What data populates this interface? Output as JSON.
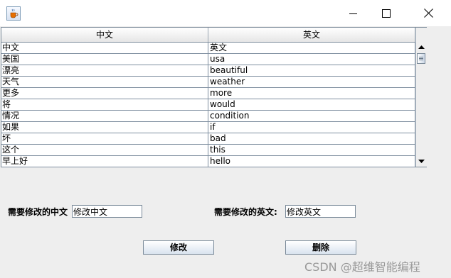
{
  "window": {
    "icon": "java-cup-icon",
    "controls": [
      "minimize-icon",
      "maximize-icon",
      "close-icon"
    ]
  },
  "table": {
    "columns": [
      "中文",
      "英文"
    ],
    "rows": [
      [
        "中文",
        "英文"
      ],
      [
        "美国",
        "usa"
      ],
      [
        "漂亮",
        "beautiful"
      ],
      [
        "天气",
        "weather"
      ],
      [
        "更多",
        "more"
      ],
      [
        "将",
        "would"
      ],
      [
        "情况",
        "condition"
      ],
      [
        "如果",
        "if"
      ],
      [
        "坏",
        "bad"
      ],
      [
        "这个",
        "this"
      ],
      [
        "早上好",
        "hello"
      ]
    ]
  },
  "form": {
    "cn_label": "需要修改的中文",
    "cn_value": "修改中文",
    "en_label": "需要修改的英文:",
    "en_value": "修改英文"
  },
  "buttons": {
    "edit": "修改",
    "delete": "删除"
  },
  "watermark": "CSDN @超维智能编程"
}
